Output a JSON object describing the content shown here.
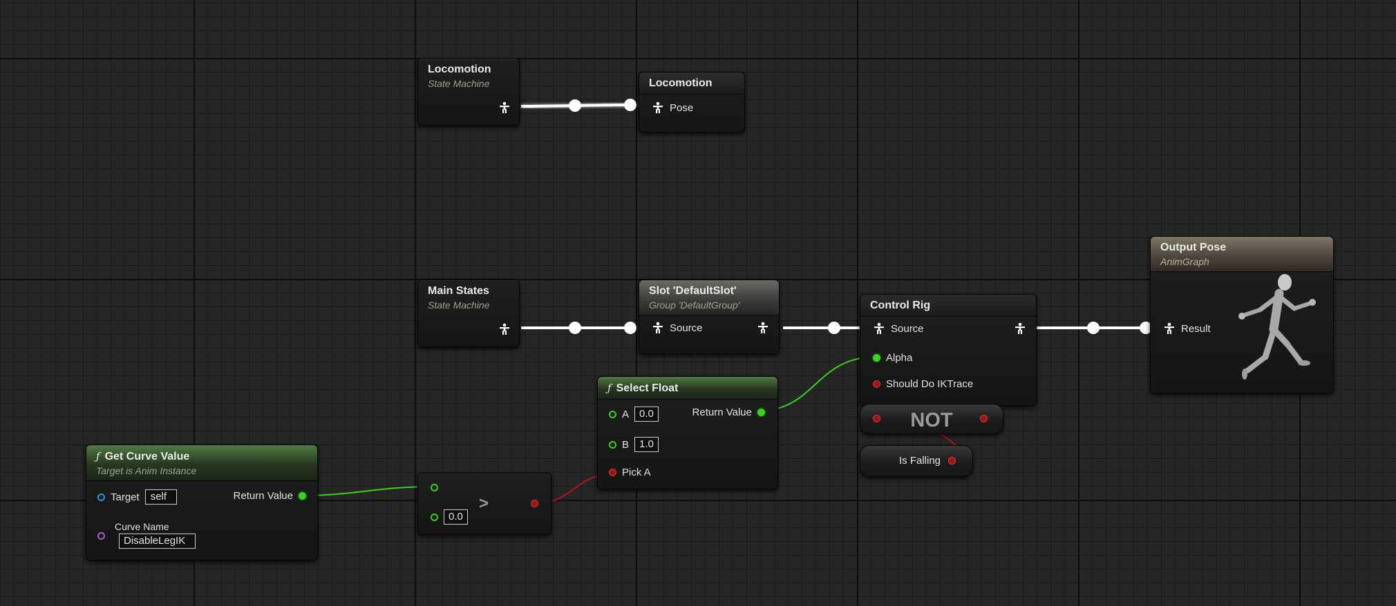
{
  "graph": {
    "locomotion_sm": {
      "title": "Locomotion",
      "subtitle": "State Machine"
    },
    "locomotion_pose": {
      "title": "Locomotion",
      "pin": "Pose"
    },
    "main_states": {
      "title": "Main States",
      "subtitle": "State Machine"
    },
    "slot": {
      "title": "Slot 'DefaultSlot'",
      "subtitle": "Group 'DefaultGroup'",
      "pin": "Source"
    },
    "control_rig": {
      "title": "Control Rig",
      "pins": [
        "Source",
        "Alpha",
        "Should Do IKTrace"
      ]
    },
    "output_pose": {
      "title": "Output Pose",
      "subtitle": "AnimGraph",
      "pin": "Result"
    },
    "select_float": {
      "title": "Select Float",
      "pins": [
        "A",
        "B",
        "Pick A"
      ],
      "a_value": "0.0",
      "b_value": "1.0",
      "return_label": "Return Value"
    },
    "not_node": {
      "title": "NOT"
    },
    "is_falling": {
      "title": "Is Falling"
    },
    "greater": {
      "op": ">",
      "b_value": "0.0"
    },
    "get_curve": {
      "title": "Get Curve Value",
      "subtitle": "Target is Anim Instance",
      "target_label": "Target",
      "target_value": "self",
      "return_label": "Return Value",
      "curve_label": "Curve Name",
      "curve_value": "DisableLegIK"
    }
  },
  "icons": {
    "pose_pin": "pose-person-icon",
    "function": "function-icon",
    "running_mannequin": "running-mannequin-icon"
  },
  "colors": {
    "exec_wire": "#ffffff",
    "float_pin": "#39d31c",
    "bool_pin": "#a31313",
    "object_pin": "#1e9de0",
    "name_pin": "#b05ad6",
    "function_header": "#4f7a42"
  }
}
